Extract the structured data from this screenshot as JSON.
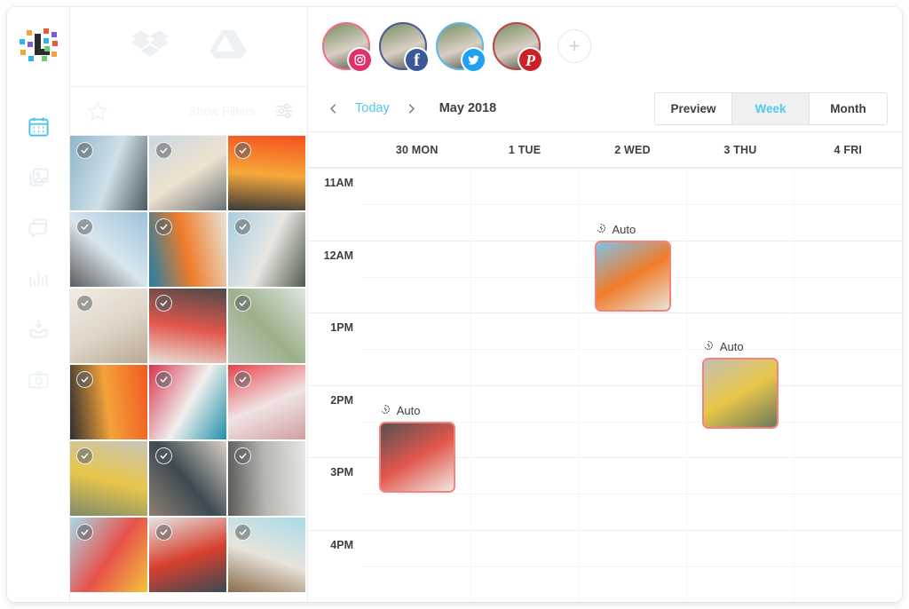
{
  "app": {
    "logo_name": "app-logo"
  },
  "rail": {
    "items": [
      {
        "icon": "calendar-icon",
        "label": "Calendar",
        "active": true
      },
      {
        "icon": "image-gallery-icon",
        "label": "Library",
        "active": false
      },
      {
        "icon": "chat-bubble-icon",
        "label": "Messages",
        "active": false
      },
      {
        "icon": "bar-chart-icon",
        "label": "Analytics",
        "active": false
      },
      {
        "icon": "inbox-download-icon",
        "label": "Inbox",
        "active": false
      },
      {
        "icon": "camera-icon",
        "label": "Capture",
        "active": false
      }
    ]
  },
  "library": {
    "cloud_sources": [
      {
        "icon": "dropbox-icon",
        "label": "Dropbox"
      },
      {
        "icon": "google-drive-icon",
        "label": "Google Drive"
      }
    ],
    "favorite_icon": "star-icon",
    "show_filters_label": "Show Filters",
    "filters_icon": "sliders-icon",
    "photos": [
      {
        "name": "palm-trees-beach",
        "c1": "#8fb6cc",
        "c2": "#cfe0e8",
        "c3": "#4a5a5e",
        "badge": "check-icon"
      },
      {
        "name": "blonde-photographer",
        "c1": "#c9d8e2",
        "c2": "#efe2cf",
        "c3": "#6a7277",
        "badge": "check-icon"
      },
      {
        "name": "woman-orange-wall",
        "c1": "#f4511e",
        "c2": "#f7a83a",
        "c3": "#3a3a3a",
        "badge": "check-icon"
      },
      {
        "name": "man-shooting-phone",
        "c1": "#9cc3dc",
        "c2": "#d9e6ee",
        "c3": "#5c5c5c",
        "badge": "check-icon"
      },
      {
        "name": "colorful-mural",
        "c1": "#e8e4d8",
        "c2": "#f07c2a",
        "c3": "#1f7fa8",
        "badge": "check-icon"
      },
      {
        "name": "palms-white-building",
        "c1": "#a8cde3",
        "c2": "#e7e7e2",
        "c3": "#4f5a4a",
        "badge": "check-icon"
      },
      {
        "name": "white-interior-flowers",
        "c1": "#f1ece4",
        "c2": "#e0d6c8",
        "c3": "#b8a894",
        "badge": "check-icon"
      },
      {
        "name": "woman-neon-sign",
        "c1": "#4c4a4a",
        "c2": "#e2564c",
        "c3": "#e8e2da",
        "badge": "check-icon"
      },
      {
        "name": "palm-poolside",
        "c1": "#dfe6e0",
        "c2": "#9bb08a",
        "c3": "#c2c9c2",
        "badge": "check-icon"
      },
      {
        "name": "woman-orange-backdrop",
        "c1": "#f05a22",
        "c2": "#f4a23a",
        "c3": "#2f2f2f",
        "badge": "check-icon"
      },
      {
        "name": "colorful-abstract-wall",
        "c1": "#d9344b",
        "c2": "#f0f0ee",
        "c3": "#1f8fa8",
        "badge": "check-icon"
      },
      {
        "name": "red-leggings-phone",
        "c1": "#e8424a",
        "c2": "#f0e4e4",
        "c3": "#d0a0a0",
        "badge": "check-icon"
      },
      {
        "name": "food-flatlay-phone",
        "c1": "#c8c5b8",
        "c2": "#e8c64a",
        "c3": "#7e8a6a",
        "badge": "check-icon"
      },
      {
        "name": "hands-phone-cafe",
        "c1": "#d9cfc4",
        "c2": "#3c4a52",
        "c3": "#8f7f70",
        "badge": "check-icon"
      },
      {
        "name": "phone-palm-shadow",
        "c1": "#e8e6e2",
        "c2": "#b8b6b2",
        "c3": "#5a5a58",
        "badge": "check-icon"
      },
      {
        "name": "poolside-drinks",
        "c1": "#a8dbe8",
        "c2": "#e8514c",
        "c3": "#f2c53a",
        "badge": "check-icon"
      },
      {
        "name": "breakfast-table",
        "c1": "#e4e6e4",
        "c2": "#d8402e",
        "c3": "#3a4a52",
        "badge": "check-icon"
      },
      {
        "name": "sandals-tiles",
        "c1": "#a8dbe8",
        "c2": "#e8e4dc",
        "c3": "#8a6a4a",
        "badge": "check-icon"
      }
    ]
  },
  "calendar": {
    "accounts": [
      {
        "name": "instagram-account",
        "network": "Instagram",
        "badge_color": "#e1306c",
        "ring_color": "#f26d8a",
        "glyph": "instagram-icon"
      },
      {
        "name": "facebook-account",
        "network": "Facebook",
        "badge_color": "#3b5998",
        "ring_color": "#4a5a9a",
        "glyph": "facebook-icon"
      },
      {
        "name": "twitter-account",
        "network": "Twitter",
        "badge_color": "#1da1f2",
        "ring_color": "#5bb8ef",
        "glyph": "twitter-icon"
      },
      {
        "name": "pinterest-account",
        "network": "Pinterest",
        "badge_color": "#cb2027",
        "ring_color": "#c0434a",
        "glyph": "pinterest-icon"
      }
    ],
    "add_account_label": "+",
    "toolbar": {
      "prev_icon": "chevron-left-icon",
      "today_label": "Today",
      "next_icon": "chevron-right-icon",
      "month_label": "May 2018",
      "views": [
        {
          "label": "Preview",
          "active": false
        },
        {
          "label": "Week",
          "active": true
        },
        {
          "label": "Month",
          "active": false
        }
      ]
    },
    "days": [
      "30 MON",
      "1 TUE",
      "2 WED",
      "3 THU",
      "4 FRI"
    ],
    "hours": [
      "11AM",
      "12AM",
      "1PM",
      "2PM",
      "3PM",
      "4PM"
    ],
    "events": [
      {
        "name": "event-mural-wed",
        "label": "Auto",
        "icon": "auto-magic-icon",
        "day_index": 2,
        "hour_index": 0,
        "offset_minutes": 45,
        "accent": "#f6827e",
        "thumb": {
          "name": "colorful-mural",
          "c1": "#7fc3e8",
          "c2": "#f07c2a",
          "c3": "#e8e4d8"
        }
      },
      {
        "name": "event-woman-neon-mon",
        "label": "Auto",
        "icon": "auto-magic-icon",
        "day_index": 0,
        "hour_index": 2,
        "offset_minutes": 75,
        "accent": "#f6827e",
        "thumb": {
          "name": "woman-neon-sign",
          "c1": "#555252",
          "c2": "#e2564c",
          "c3": "#efe9e2"
        }
      },
      {
        "name": "event-food-flatlay-thu",
        "label": "Auto",
        "icon": "auto-magic-icon",
        "day_index": 3,
        "hour_index": 2,
        "offset_minutes": 22,
        "accent": "#f6827e",
        "thumb": {
          "name": "food-flatlay-phone",
          "c1": "#c4c0b4",
          "c2": "#e8c64a",
          "c3": "#6e7a5a"
        }
      }
    ]
  },
  "colors": {
    "accent_blue": "#53c7ef",
    "event_border": "#f6827e",
    "text_dark": "#3c4043",
    "grid_line": "#ededed"
  }
}
